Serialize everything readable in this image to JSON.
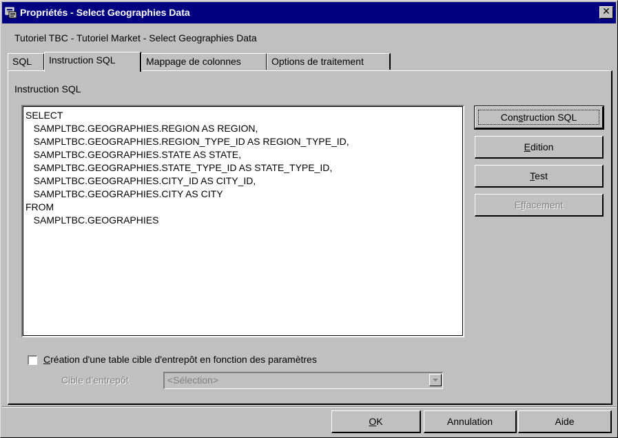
{
  "window": {
    "title": "Propriétés - Select Geographies Data",
    "close_symbol": "✕",
    "icon": "app-properties-icon"
  },
  "subtitle": "Tutoriel TBC - Tutoriel Market - Select Geographies Data",
  "tabs": [
    {
      "label": "SQL",
      "active": false
    },
    {
      "label": "Instruction SQL",
      "active": true
    },
    {
      "label": "Mappage de colonnes",
      "active": false
    },
    {
      "label": "Options de traitement",
      "active": false
    }
  ],
  "panel": {
    "label": "Instruction SQL",
    "sql_text": "SELECT\n   SAMPLTBC.GEOGRAPHIES.REGION AS REGION,\n   SAMPLTBC.GEOGRAPHIES.REGION_TYPE_ID AS REGION_TYPE_ID,\n   SAMPLTBC.GEOGRAPHIES.STATE AS STATE,\n   SAMPLTBC.GEOGRAPHIES.STATE_TYPE_ID AS STATE_TYPE_ID,\n   SAMPLTBC.GEOGRAPHIES.CITY_ID AS CITY_ID,\n   SAMPLTBC.GEOGRAPHIES.CITY AS CITY\nFROM\n   SAMPLTBC.GEOGRAPHIES"
  },
  "side_buttons": {
    "build_sql": {
      "before": "Con",
      "mnemonic": "s",
      "after": "truction SQL"
    },
    "edit": {
      "before": "",
      "mnemonic": "E",
      "after": "dition"
    },
    "test": {
      "before": "",
      "mnemonic": "T",
      "after": "est"
    },
    "clear": {
      "before": "E",
      "mnemonic": "f",
      "after": "facement",
      "disabled": true
    }
  },
  "create_table": {
    "checked": false,
    "label_mnemonic": "C",
    "label_rest": "réation d'une table cible d'entrepôt en fonction des paramètres"
  },
  "target": {
    "label": "Cible d'entrepôt",
    "selected": "<Sélection>",
    "disabled": true
  },
  "footer": {
    "ok": {
      "mnemonic": "O",
      "after": "K"
    },
    "cancel": "Annulation",
    "help": "Aide"
  }
}
